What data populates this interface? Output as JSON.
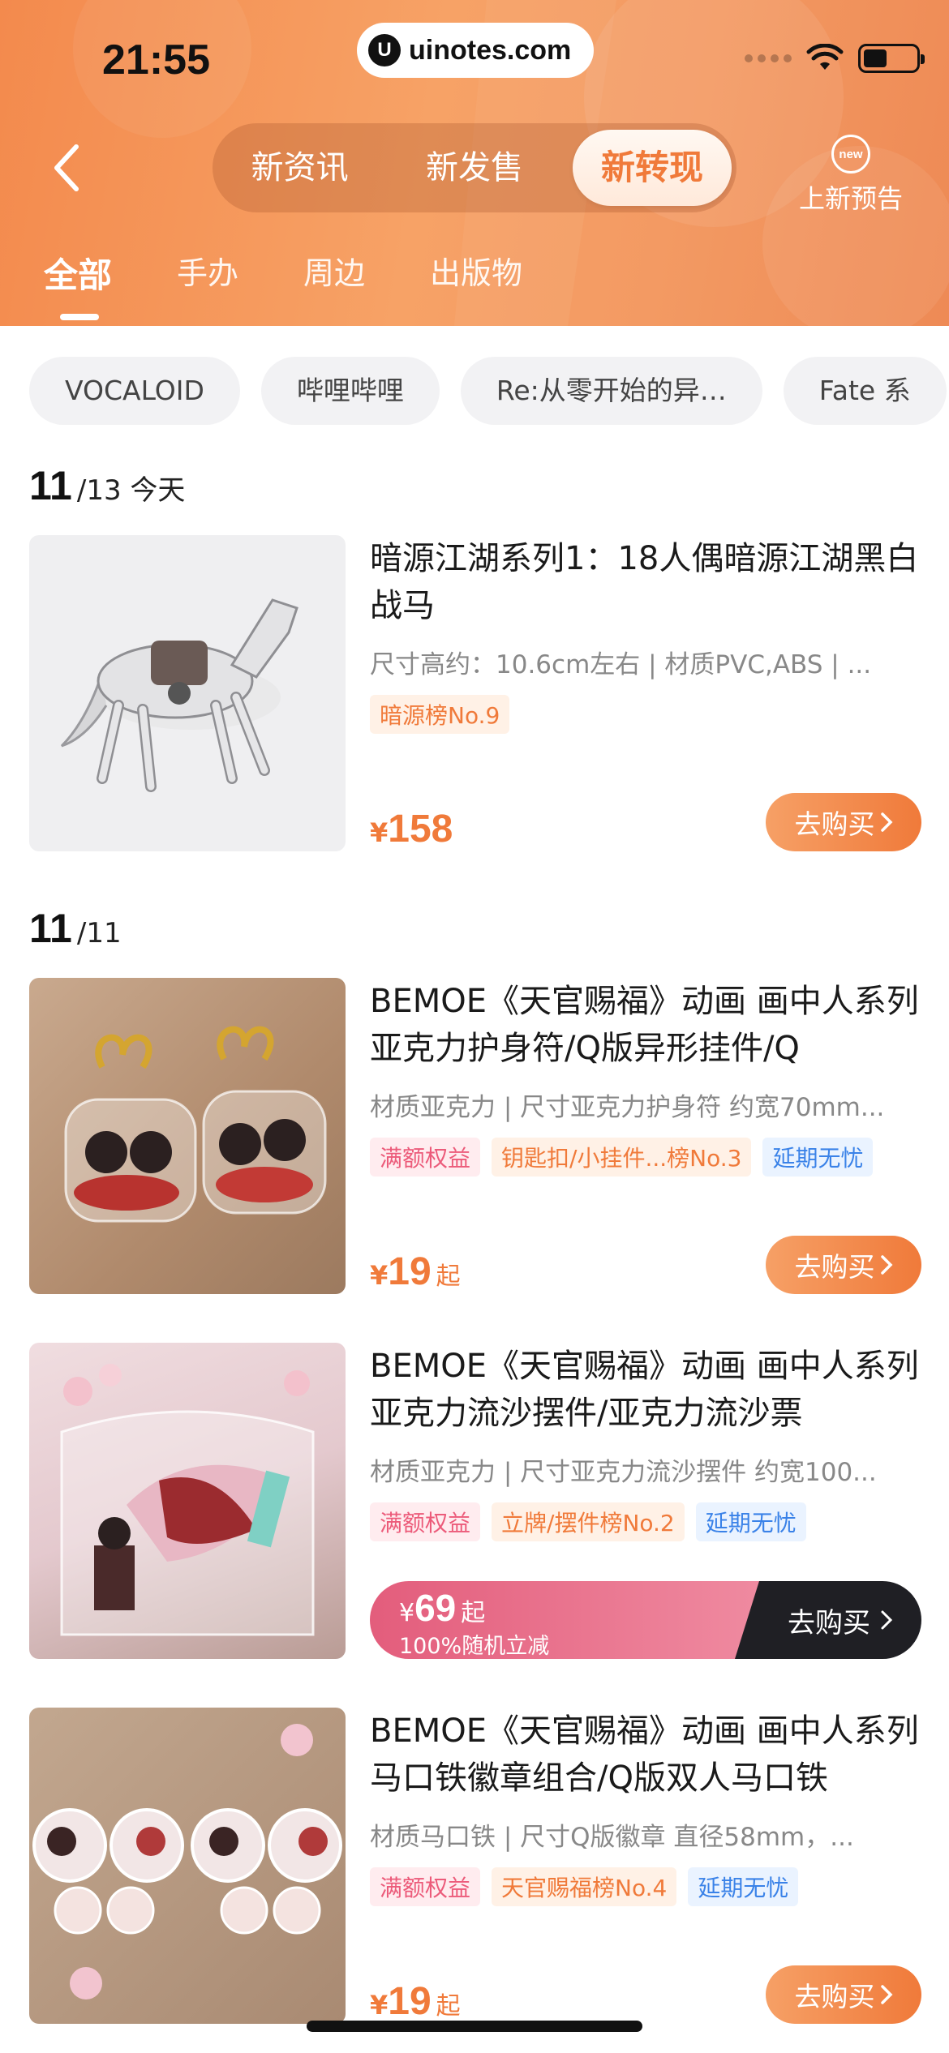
{
  "status_bar": {
    "time": "21:55",
    "url": "uinotes.com"
  },
  "header": {
    "segments": [
      "新资讯",
      "新发售",
      "新转现"
    ],
    "active_segment": "新转现",
    "preview_badge": "new",
    "preview_label": "上新预告",
    "categories": [
      "全部",
      "手办",
      "周边",
      "出版物"
    ],
    "active_category": "全部",
    "accent_color": "#f38a4d"
  },
  "chips": [
    "VOCALOID",
    "哔哩哔哩",
    "Re:从零开始的异…",
    "Fate 系"
  ],
  "groups": [
    {
      "date_num": "11",
      "date_rest": "/13 今天"
    },
    {
      "date_num": "11",
      "date_rest": "/11"
    }
  ],
  "products": [
    {
      "title": "暗源江湖系列1：18人偶暗源江湖黑白战马",
      "spec": "尺寸高约：10.6cm左右 | 材质PVC,ABS | ...",
      "tags": [
        {
          "text": "暗源榜No.9",
          "style": "orange"
        }
      ],
      "price_symbol": "¥",
      "price": "158",
      "price_suffix": "",
      "button": "去购买"
    },
    {
      "title": "BEMOE《天官赐福》动画 画中人系列 亚克力护身符/Q版异形挂件/Q",
      "spec": "材质亚克力 | 尺寸亚克力护身符 约宽70mm...",
      "tags": [
        {
          "text": "满额权益",
          "style": "pink"
        },
        {
          "text": "钥匙扣/小挂件...榜No.3",
          "style": "orange"
        },
        {
          "text": "延期无忧",
          "style": "blue"
        }
      ],
      "price_symbol": "¥",
      "price": "19",
      "price_suffix": "起",
      "button": "去购买"
    },
    {
      "title": "BEMOE《天官赐福》动画 画中人系列 亚克力流沙摆件/亚克力流沙票",
      "spec": "材质亚克力 | 尺寸亚克力流沙摆件 约宽100...",
      "tags": [
        {
          "text": "满额权益",
          "style": "pink"
        },
        {
          "text": "立牌/摆件榜No.2",
          "style": "orange"
        },
        {
          "text": "延期无忧",
          "style": "blue"
        }
      ],
      "price_symbol": "¥",
      "price": "69",
      "price_suffix": "起",
      "promo_text": "100%随机立减",
      "button": "去购买"
    },
    {
      "title": "BEMOE《天官赐福》动画 画中人系列 马口铁徽章组合/Q版双人马口铁",
      "spec": "材质马口铁 | 尺寸Q版徽章 直径58mm，...",
      "tags": [
        {
          "text": "满额权益",
          "style": "pink"
        },
        {
          "text": "天官赐福榜No.4",
          "style": "orange"
        },
        {
          "text": "延期无忧",
          "style": "blue"
        }
      ],
      "price_symbol": "¥",
      "price": "19",
      "price_suffix": "起",
      "button": "去购买"
    }
  ]
}
